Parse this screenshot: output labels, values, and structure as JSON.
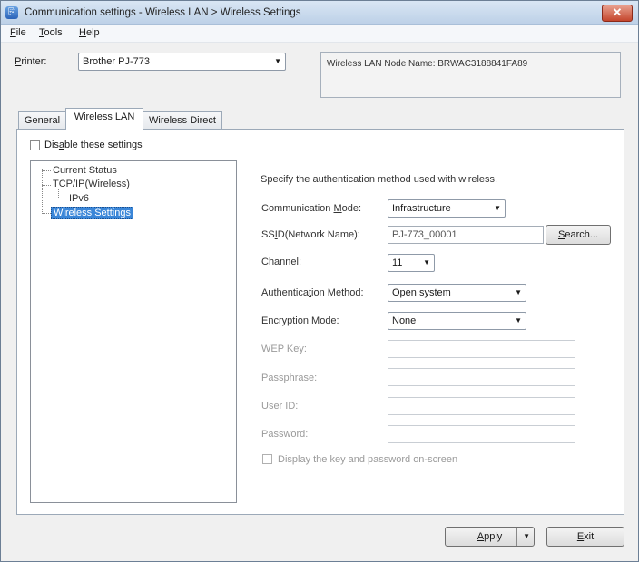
{
  "window": {
    "title": "Communication settings - Wireless LAN > Wireless Settings",
    "close_glyph": "✕"
  },
  "menu": [
    {
      "label": "File",
      "mnemonic": "F",
      "rest": "ile"
    },
    {
      "label": "Tools",
      "mnemonic": "T",
      "rest": "ools"
    },
    {
      "label": "Help",
      "mnemonic": "H",
      "rest": "elp"
    }
  ],
  "printer": {
    "label_mn": "P",
    "label_rest": "rinter:",
    "value": "Brother PJ-773"
  },
  "info": {
    "node_name_text": "Wireless LAN Node Name: BRWAC3188841FA89"
  },
  "tabs": [
    {
      "label": "General",
      "active": false
    },
    {
      "label": "Wireless LAN",
      "active": true
    },
    {
      "label": "Wireless Direct",
      "active": false
    }
  ],
  "disable_settings": {
    "label_pre": "Dis",
    "label_mn": "a",
    "label_post": "ble these settings",
    "checked": false
  },
  "tree": {
    "items": [
      {
        "label": "Current Status"
      },
      {
        "label": "TCP/IP(Wireless)"
      },
      {
        "label": "IPv6"
      },
      {
        "label": "Wireless Settings",
        "selected": true
      }
    ]
  },
  "form": {
    "hint": "Specify the authentication method used with wireless.",
    "communication_mode": {
      "label_pre": "Communication ",
      "label_mn": "M",
      "label_post": "ode:",
      "value": "Infrastructure"
    },
    "ssid": {
      "label_pre": "SS",
      "label_mn": "I",
      "label_post": "D(Network Name):",
      "value": "PJ-773_00001"
    },
    "search_button": {
      "mn": "S",
      "rest": "earch..."
    },
    "channel": {
      "label_pre": "Channe",
      "label_mn": "l",
      "label_post": ":",
      "value": "11"
    },
    "auth_method": {
      "label_pre": "Authentica",
      "label_mn": "t",
      "label_post": "ion Method:",
      "value": "Open system"
    },
    "encryption_mode": {
      "label_pre": "Encr",
      "label_mn": "y",
      "label_post": "ption Mode:",
      "value": "None"
    },
    "wep_key": {
      "label": "WEP Key:",
      "value": ""
    },
    "passphrase": {
      "label": "Passphrase:",
      "value": ""
    },
    "user_id": {
      "label": "User ID:",
      "value": ""
    },
    "password": {
      "label": "Password:",
      "value": ""
    },
    "display_key": {
      "label": "Display the key and password on-screen",
      "checked": false
    }
  },
  "footer": {
    "apply": {
      "mn": "A",
      "rest": "pply"
    },
    "exit": {
      "mn": "E",
      "rest": "xit"
    }
  }
}
